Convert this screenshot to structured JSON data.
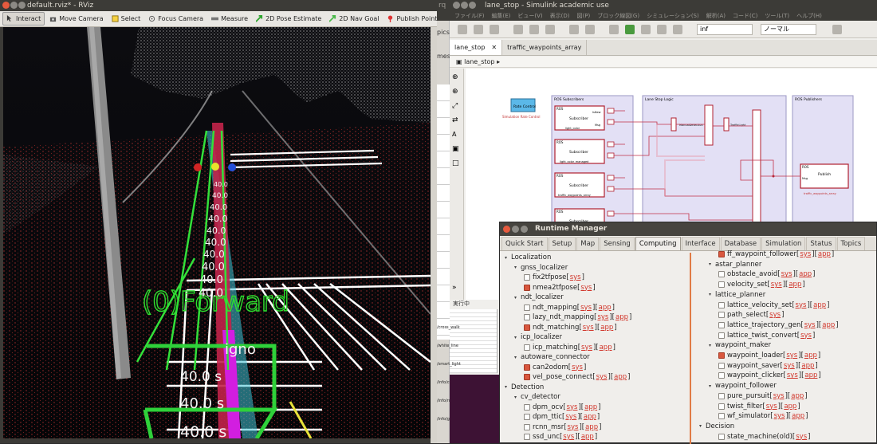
{
  "rviz": {
    "title": "default.rviz* - RViz",
    "tools": [
      {
        "label": "Interact",
        "icon": "cursor-icon"
      },
      {
        "label": "Move Camera",
        "icon": "camera-icon"
      },
      {
        "label": "Select",
        "icon": "select-box-icon"
      },
      {
        "label": "Focus Camera",
        "icon": "focus-icon"
      },
      {
        "label": "Measure",
        "icon": "ruler-icon"
      },
      {
        "label": "2D Pose Estimate",
        "icon": "green-arrow-icon"
      },
      {
        "label": "2D Nav Goal",
        "icon": "green-flag-icon"
      },
      {
        "label": "Publish Point",
        "icon": "red-pin-icon"
      }
    ],
    "overlay": {
      "forward_text": "(0)Forward",
      "ignore_text": "igno",
      "speed_labels": [
        "40.0",
        "40.0",
        "40.0",
        "40.0",
        "40.0",
        "40.0",
        "40.0",
        "40.0",
        "40.0",
        "40.0"
      ],
      "time_labels": [
        "40.0 s",
        "40.0 s",
        "40.0 s"
      ]
    }
  },
  "simulink": {
    "title": "lane_stop - Simulink academic use",
    "menu": [
      "ファイル(F)",
      "編集(E)",
      "ビュー(V)",
      "表示(D)",
      "図(P)",
      "ブロック線図(G)",
      "シミュレーション(S)",
      "解析(A)",
      "コード(C)",
      "ツール(T)",
      "ヘルプ(H)"
    ],
    "tabs": [
      "lane_stop",
      "traffic_waypoints_array"
    ],
    "breadcrumb": "lane_stop",
    "side_truncated": [
      "rq",
      "pics",
      "mes"
    ],
    "status_text": "実行中",
    "sim_time": "inf",
    "mode": "ノーマル",
    "blocks": {
      "rate_control": "Rate Control",
      "rate_label": "Simulation Rate Control",
      "subscribers_area": "ROS Subscribers",
      "logic_area": "Lane Stop Logic",
      "publishers_area": "ROS Publishers",
      "subscriber": "Subscriber",
      "publish": "Publish",
      "ros": "ROS",
      "isnew": "IsNew",
      "msg": "Msg",
      "sub_labels": [
        "light_color",
        "light_color_managed",
        "traffic_waypoints_array",
        ""
      ],
      "pub_label": "traffic_waypoints_array",
      "manual_detection": "ManualDetection",
      "traffic_light": "TrafficLight"
    },
    "explorer_items": [
      "/cross_walk",
      "/white_line",
      "/smart_light",
      "/info/current",
      "/info/road",
      "/info/gui"
    ]
  },
  "runtime_manager": {
    "title": "Runtime Manager",
    "tabs": [
      "Quick Start",
      "Setup",
      "Map",
      "Sensing",
      "Computing",
      "Interface",
      "Database",
      "Simulation",
      "Status",
      "Topics"
    ],
    "active_tab": "Computing",
    "left_tree": [
      {
        "level": 0,
        "type": "group",
        "label": "Localization"
      },
      {
        "level": 1,
        "type": "group",
        "label": "gnss_localizer"
      },
      {
        "level": 2,
        "type": "item",
        "label": "fix2tfpose",
        "checked": false,
        "links": [
          "sys"
        ]
      },
      {
        "level": 2,
        "type": "item",
        "label": "nmea2tfpose",
        "checked": true,
        "links": [
          "sys"
        ]
      },
      {
        "level": 1,
        "type": "group",
        "label": "ndt_localizer"
      },
      {
        "level": 2,
        "type": "item",
        "label": "ndt_mapping",
        "checked": false,
        "links": [
          "sys",
          "app"
        ]
      },
      {
        "level": 2,
        "type": "item",
        "label": "lazy_ndt_mapping",
        "checked": false,
        "links": [
          "sys",
          "app"
        ]
      },
      {
        "level": 2,
        "type": "item",
        "label": "ndt_matching",
        "checked": true,
        "links": [
          "sys",
          "app"
        ]
      },
      {
        "level": 1,
        "type": "group",
        "label": "icp_localizer"
      },
      {
        "level": 2,
        "type": "item",
        "label": "icp_matching",
        "checked": false,
        "links": [
          "sys",
          "app"
        ]
      },
      {
        "level": 1,
        "type": "group",
        "label": "autoware_connector"
      },
      {
        "level": 2,
        "type": "item",
        "label": "can2odom",
        "checked": true,
        "links": [
          "sys"
        ]
      },
      {
        "level": 2,
        "type": "item",
        "label": "vel_pose_connect",
        "checked": true,
        "links": [
          "sys",
          "app"
        ]
      },
      {
        "level": 0,
        "type": "group",
        "label": "Detection"
      },
      {
        "level": 1,
        "type": "group",
        "label": "cv_detector"
      },
      {
        "level": 2,
        "type": "item",
        "label": "dpm_ocv",
        "checked": false,
        "links": [
          "sys",
          "app"
        ]
      },
      {
        "level": 2,
        "type": "item",
        "label": "dpm_ttic",
        "checked": false,
        "links": [
          "sys",
          "app"
        ]
      },
      {
        "level": 2,
        "type": "item",
        "label": "rcnn_msr",
        "checked": false,
        "links": [
          "sys",
          "app"
        ]
      },
      {
        "level": 2,
        "type": "item",
        "label": "ssd_unc",
        "checked": false,
        "links": [
          "sys",
          "app"
        ]
      }
    ],
    "right_tree": [
      {
        "level": 2,
        "type": "item",
        "label": "ff_waypoint_follower",
        "checked": true,
        "links": [
          "sys",
          "app"
        ]
      },
      {
        "level": 1,
        "type": "group",
        "label": "astar_planner"
      },
      {
        "level": 2,
        "type": "item",
        "label": "obstacle_avoid",
        "checked": false,
        "links": [
          "sys",
          "app"
        ]
      },
      {
        "level": 2,
        "type": "item",
        "label": "velocity_set",
        "checked": false,
        "links": [
          "sys",
          "app"
        ]
      },
      {
        "level": 1,
        "type": "group",
        "label": "lattice_planner"
      },
      {
        "level": 2,
        "type": "item",
        "label": "lattice_velocity_set",
        "checked": false,
        "links": [
          "sys",
          "app"
        ]
      },
      {
        "level": 2,
        "type": "item",
        "label": "path_select",
        "checked": false,
        "links": [
          "sys"
        ]
      },
      {
        "level": 2,
        "type": "item",
        "label": "lattice_trajectory_gen",
        "checked": false,
        "links": [
          "sys",
          "app"
        ]
      },
      {
        "level": 2,
        "type": "item",
        "label": "lattice_twist_convert",
        "checked": false,
        "links": [
          "sys"
        ]
      },
      {
        "level": 1,
        "type": "group",
        "label": "waypoint_maker"
      },
      {
        "level": 2,
        "type": "item",
        "label": "waypoint_loader",
        "checked": true,
        "links": [
          "sys",
          "app"
        ]
      },
      {
        "level": 2,
        "type": "item",
        "label": "waypoint_saver",
        "checked": false,
        "links": [
          "sys",
          "app"
        ]
      },
      {
        "level": 2,
        "type": "item",
        "label": "waypoint_clicker",
        "checked": false,
        "links": [
          "sys",
          "app"
        ]
      },
      {
        "level": 1,
        "type": "group",
        "label": "waypoint_follower"
      },
      {
        "level": 2,
        "type": "item",
        "label": "pure_pursuit",
        "checked": false,
        "links": [
          "sys",
          "app"
        ]
      },
      {
        "level": 2,
        "type": "item",
        "label": "twist_filter",
        "checked": false,
        "links": [
          "sys",
          "app"
        ]
      },
      {
        "level": 2,
        "type": "item",
        "label": "wf_simulator",
        "checked": false,
        "links": [
          "sys",
          "app"
        ]
      },
      {
        "level": 0,
        "type": "group",
        "label": "Decision"
      },
      {
        "level": 2,
        "type": "item",
        "label": "state_machine(old)",
        "checked": false,
        "links": [
          "sys"
        ]
      }
    ]
  }
}
